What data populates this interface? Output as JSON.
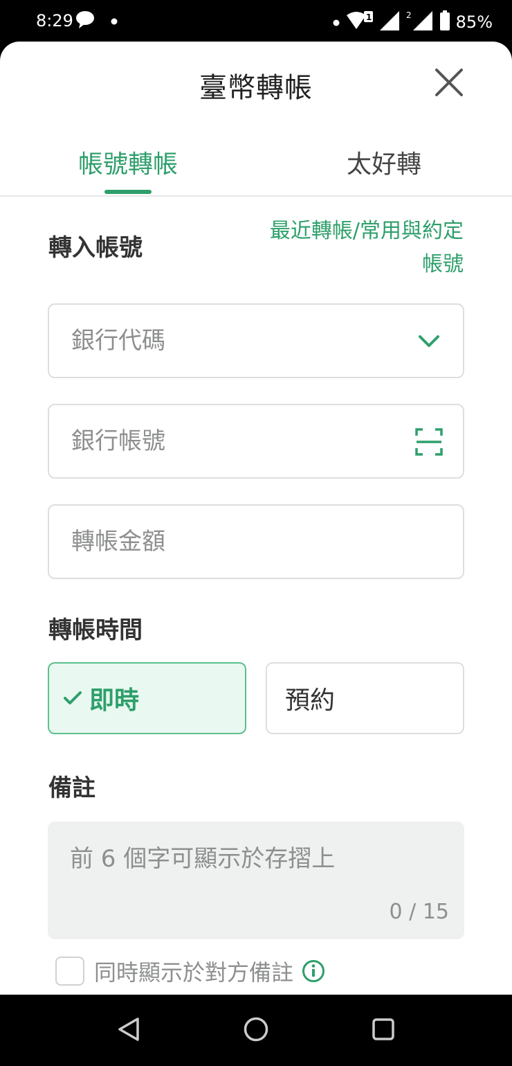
{
  "status_bar": {
    "time": "8:29",
    "battery": "85%"
  },
  "header": {
    "title": "臺幣轉帳"
  },
  "tabs": [
    {
      "label": "帳號轉帳",
      "active": true
    },
    {
      "label": "太好轉",
      "active": false
    }
  ],
  "transfer_account": {
    "label": "轉入帳號",
    "recent_link_line1": "最近轉帳/常用與約定",
    "recent_link_line2": "帳號",
    "bank_code_placeholder": "銀行代碼",
    "account_number_placeholder": "銀行帳號",
    "amount_placeholder": "轉帳金額"
  },
  "transfer_time": {
    "label": "轉帳時間",
    "options": [
      {
        "label": "即時",
        "selected": true
      },
      {
        "label": "預約",
        "selected": false
      }
    ]
  },
  "memo": {
    "label": "備註",
    "placeholder": "前 6 個字可顯示於存摺上",
    "counter": "0 / 15",
    "show_to_recipient_label": "同時顯示於對方備註"
  },
  "colors": {
    "accent": "#2e9f6b",
    "selected_bg": "#e9f8f0"
  }
}
